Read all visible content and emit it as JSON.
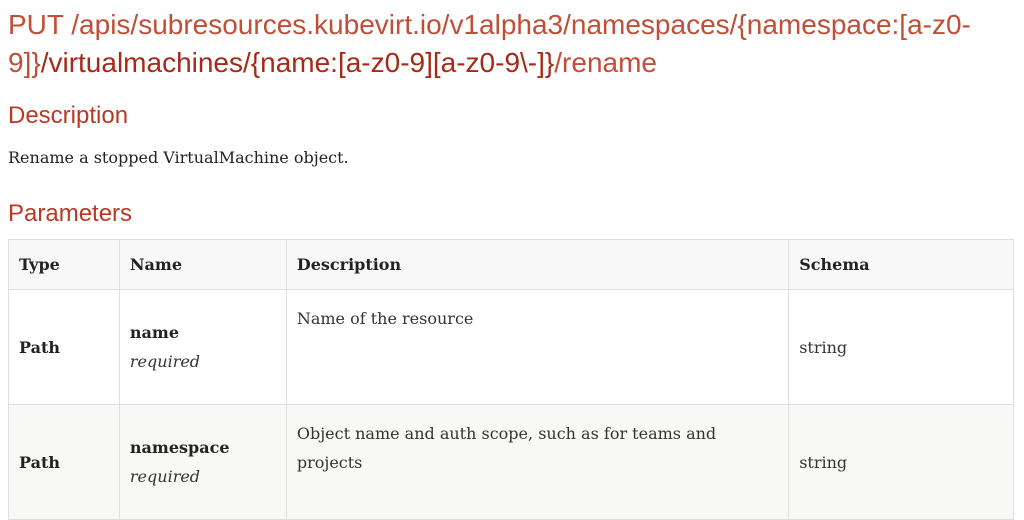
{
  "endpoint": {
    "method_path_light": "PUT /apis/subresources.kubevirt.io/v1alpha3/namespaces/{namespace:[a-z0-9]}",
    "path_dark": "/virtualmachines/{name:[a-z0-9][a-z0-9\\-]}",
    "path_tail": "/rename"
  },
  "description": {
    "heading": "Description",
    "text": "Rename a stopped VirtualMachine object."
  },
  "parameters": {
    "heading": "Parameters",
    "columns": [
      "Type",
      "Name",
      "Description",
      "Schema"
    ],
    "rows": [
      {
        "type": "Path",
        "name": "name",
        "required_label": "required",
        "description": "Name of the resource",
        "schema": "string"
      },
      {
        "type": "Path",
        "name": "namespace",
        "required_label": "required",
        "description": "Object name and auth scope, such as for teams and projects",
        "schema": "string"
      }
    ]
  }
}
